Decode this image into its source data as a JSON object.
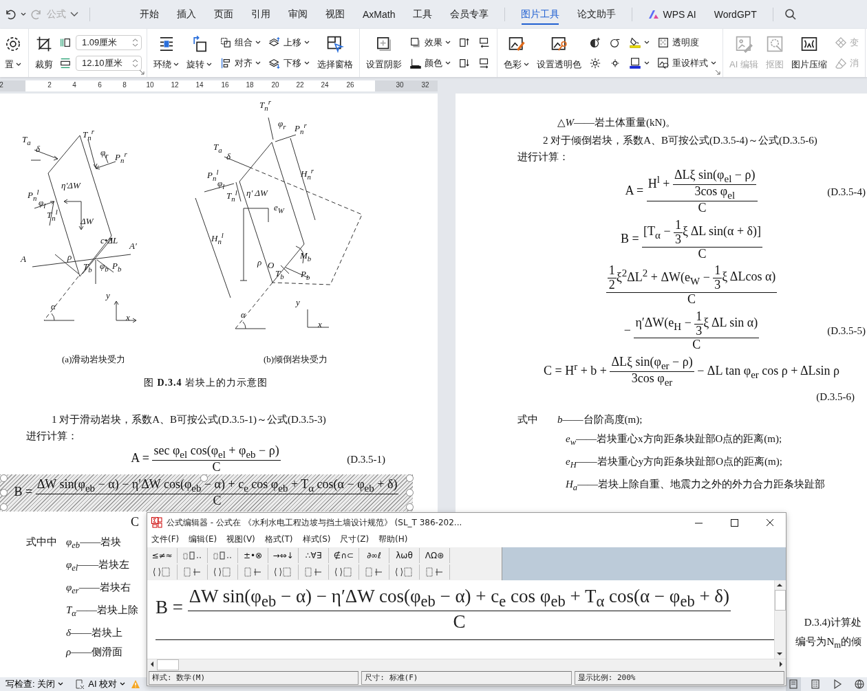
{
  "quick_access": {
    "title": "公式"
  },
  "tab_groups": [
    [
      {
        "label": "开始",
        "selected": false,
        "kind": "plain"
      },
      {
        "label": "插入",
        "selected": false,
        "kind": "plain"
      },
      {
        "label": "页面",
        "selected": false,
        "kind": "plain"
      },
      {
        "label": "引用",
        "selected": false,
        "kind": "plain"
      },
      {
        "label": "审阅",
        "selected": false,
        "kind": "plain"
      },
      {
        "label": "视图",
        "selected": false,
        "kind": "plain"
      },
      {
        "label": "AxMath",
        "selected": false,
        "kind": "plain"
      },
      {
        "label": "工具",
        "selected": false,
        "kind": "plain"
      },
      {
        "label": "会员专享",
        "selected": false,
        "kind": "plain"
      }
    ],
    [
      {
        "label": "图片工具",
        "selected": true,
        "kind": "plain"
      },
      {
        "label": "论文助手",
        "selected": false,
        "kind": "plain"
      }
    ],
    [
      {
        "label": "WPS AI",
        "selected": false,
        "kind": "ai"
      },
      {
        "label": "WordGPT",
        "selected": false,
        "kind": "plain"
      }
    ]
  ],
  "ribbon": {
    "groups": [
      {
        "items": [
          {
            "kind": "large",
            "label": "置",
            "chevron": true,
            "disabled": false
          }
        ]
      },
      {
        "items": [
          {
            "kind": "large",
            "label": "裁剪",
            "chevron": false,
            "disabled": false
          },
          {
            "kind": "stack",
            "rows": [
              {
                "kind": "field",
                "value": "1.09厘米"
              },
              {
                "kind": "field",
                "value": "12.10厘米"
              }
            ]
          },
          {
            "kind": "launcher"
          }
        ]
      },
      {
        "items": [
          {
            "kind": "large",
            "label": "环绕",
            "chevron": true,
            "disabled": false
          },
          {
            "kind": "large",
            "label": "旋转",
            "chevron": true,
            "disabled": false
          },
          {
            "kind": "stack",
            "rows": [
              {
                "kind": "small",
                "label": "组合",
                "chevron": true,
                "disabled": false
              },
              {
                "kind": "small",
                "label": "对齐",
                "chevron": true,
                "disabled": false
              }
            ]
          },
          {
            "kind": "stack",
            "rows": [
              {
                "kind": "small",
                "label": "上移",
                "chevron": true,
                "disabled": false
              },
              {
                "kind": "small",
                "label": "下移",
                "chevron": true,
                "disabled": false
              }
            ]
          },
          {
            "kind": "large",
            "label": "选择窗格",
            "chevron": false,
            "disabled": false
          }
        ]
      },
      {
        "items": [
          {
            "kind": "large",
            "label": "设置阴影",
            "chevron": false,
            "disabled": false
          },
          {
            "kind": "stack",
            "rows": [
              {
                "kind": "small",
                "label": "效果",
                "chevron": true,
                "disabled": false
              },
              {
                "kind": "small",
                "label": "颜色",
                "chevron": true,
                "disabled": false
              }
            ]
          },
          {
            "kind": "stack",
            "rows": [
              {
                "kind": "icon",
                "chevron": false
              },
              {
                "kind": "icon",
                "chevron": false
              }
            ]
          },
          {
            "kind": "stack",
            "rows": [
              {
                "kind": "icon",
                "chevron": false
              },
              {
                "kind": "icon",
                "chevron": false
              }
            ]
          }
        ]
      },
      {
        "items": [
          {
            "kind": "large",
            "label": "色彩",
            "chevron": true,
            "disabled": false
          },
          {
            "kind": "large",
            "label": "设置透明色",
            "chevron": false,
            "disabled": false
          },
          {
            "kind": "stack",
            "rows": [
              {
                "kind": "icon",
                "chevron": false
              },
              {
                "kind": "icon",
                "chevron": false
              }
            ]
          },
          {
            "kind": "stack",
            "rows": [
              {
                "kind": "icon",
                "chevron": false
              },
              {
                "kind": "icon",
                "chevron": false
              }
            ]
          },
          {
            "kind": "stack",
            "rows": [
              {
                "kind": "icon",
                "chevron": true
              },
              {
                "kind": "icon",
                "chevron": true
              }
            ]
          },
          {
            "kind": "stack",
            "rows": [
              {
                "kind": "small",
                "label": "透明度",
                "chevron": false,
                "disabled": false
              },
              {
                "kind": "small",
                "label": "重设样式",
                "chevron": true,
                "disabled": false
              }
            ]
          },
          {
            "kind": "launcher"
          }
        ]
      },
      {
        "items": [
          {
            "kind": "large",
            "label": "AI 编辑",
            "chevron": false,
            "disabled": true
          },
          {
            "kind": "large",
            "label": "抠图",
            "chevron": false,
            "disabled": true
          },
          {
            "kind": "large",
            "label": "图片压缩",
            "chevron": false,
            "disabled": false
          },
          {
            "kind": "stack",
            "rows": [
              {
                "kind": "small",
                "label": "变",
                "chevron": false,
                "disabled": true
              },
              {
                "kind": "small",
                "label": "消",
                "chevron": false,
                "disabled": true
              }
            ]
          }
        ]
      }
    ]
  },
  "ruler": {
    "ticks": [
      "2",
      "2",
      "4",
      "6",
      "8",
      "10",
      "12",
      "14",
      "16",
      "18",
      "20",
      "22",
      "24",
      "26",
      "30",
      "32"
    ]
  },
  "left_page": {
    "figures": [
      {
        "caption": "(a)滑动岩块受力",
        "labels": [
          "T$_{a}$",
          "δ",
          "T$_{n}$$^{r}$",
          "φ$_{r}$",
          "P$_{n}$$^{r}$",
          "η′ΔW",
          "P$_{n}$$^{l}$",
          "φ$_{l}$",
          "T$_{n}$$^{l}$",
          "ΔW",
          "c•ΔL",
          "A",
          "A′",
          "ρ",
          "T$_{b}$",
          "φ$_{b}$",
          "P$_{b}$",
          "y",
          "x",
          "α"
        ]
      },
      {
        "caption": "(b)倾倒岩块受力",
        "labels": [
          "T$_{n}$$^{r}$",
          "φ$_{r}$",
          "P$_{n}$$^{r}$",
          "T$_{a}$",
          "δ",
          "P$_{n}$$^{l}$",
          "φ$_{l}$",
          "T$_{n}$$^{l}$",
          "η′ ΔW",
          "e$_{W}$",
          "H$_{n}$$^{r}$",
          "H$_{n}$$^{l}$",
          "M$_{b}$",
          "ρ",
          "O",
          "T$_{b}$",
          "P$_{b}$",
          "y",
          "x",
          "α"
        ]
      }
    ],
    "figure_caption": "图 **D.3.4** 岩块上的力示意图",
    "blocks": [
      {
        "kind": "para",
        "text": "1 对于滑动岩块，系数A、B可按公式(D.3.5-1)～公式(D.3.5-3)"
      },
      {
        "kind": "line",
        "text": "进行计算："
      },
      {
        "kind": "formula",
        "label": "(D.3.5-1)",
        "selected": false,
        "parts": [
          {
            "text": "A = "
          },
          {
            "fraction": {
              "num": [
                {
                  "text": "sec φ$_{el}$ cos(φ$_{el}$ + φ$_{eb}$ − ρ)"
                }
              ],
              "den": [
                {
                  "text": "C"
                }
              ]
            }
          }
        ]
      },
      {
        "kind": "formula",
        "selected": true,
        "parts": [
          {
            "text": "B = "
          },
          {
            "fraction": {
              "num": [
                {
                  "text": "ΔW sin(φ$_{eb}$ − α) − η′ΔW cos(φ$_{eb}$ − α) + c$_{e}$ cos φ$_{eb}$ + T$_{α}$ cos(α − φ$_{eb}$ + δ)"
                }
              ],
              "den": [
                {
                  "text": "C"
                }
              ]
            }
          }
        ]
      },
      {
        "kind": "partial",
        "text": "C"
      },
      {
        "kind": "def",
        "lead": "式中中",
        "term": "φ$_{eb}$",
        "text": "——岩块"
      },
      {
        "kind": "def",
        "term": "φ$_{el}$",
        "text": "——岩块左"
      },
      {
        "kind": "def",
        "term": "φ$_{er}$",
        "text": "——岩块右"
      },
      {
        "kind": "def",
        "term": "T$_{α}$",
        "text": "——岩块上除"
      },
      {
        "kind": "def",
        "term": "δ",
        "text": "——岩块上"
      },
      {
        "kind": "def",
        "term": "ρ",
        "text": "——侧滑面"
      }
    ]
  },
  "right_page": {
    "blocks": [
      {
        "kind": "def",
        "term": "△W",
        "text": "——岩土体重量(kN)。"
      },
      {
        "kind": "para",
        "text": "2 对于倾倒岩块，系数A、B可按公式(D.3.5-4)～公式(D.3.5-6)"
      },
      {
        "kind": "line",
        "text": "进行计算："
      },
      {
        "kind": "formula",
        "label": "(D.3.5-4)",
        "selected": false,
        "parts": [
          {
            "text": "A = "
          },
          {
            "fraction": {
              "num": [
                {
                  "text": "H$^{l}$ + "
                },
                {
                  "fraction": {
                    "num": [
                      {
                        "text": "ΔLξ sin(φ$_{el}$ − ρ)"
                      }
                    ],
                    "den": [
                      {
                        "text": "3cos φ$_{el}$"
                      }
                    ]
                  }
                }
              ],
              "den": [
                {
                  "text": "C"
                }
              ]
            }
          }
        ]
      },
      {
        "kind": "formula",
        "selected": false,
        "parts": [
          {
            "text": "B = "
          },
          {
            "fraction": {
              "num": [
                {
                  "text": "[T$_{α}$ − "
                },
                {
                  "fraction": {
                    "num": [
                      {
                        "text": "1"
                      }
                    ],
                    "den": [
                      {
                        "text": "3"
                      }
                    ]
                  }
                },
                {
                  "text": "ξ ΔL sin(α + δ)]"
                }
              ],
              "den": [
                {
                  "text": "C"
                }
              ]
            }
          }
        ]
      },
      {
        "kind": "formula",
        "selected": false,
        "parts": [
          {
            "fraction": {
              "num": [
                {
                  "fraction": {
                    "num": [
                      {
                        "text": "1"
                      }
                    ],
                    "den": [
                      {
                        "text": "2"
                      }
                    ]
                  }
                },
                {
                  "text": "ξ$^{2}$ΔL$^{2}$ + ΔW(e$_{W}$ − "
                },
                {
                  "fraction": {
                    "num": [
                      {
                        "text": "1"
                      }
                    ],
                    "den": [
                      {
                        "text": "3"
                      }
                    ]
                  }
                },
                {
                  "text": "ξ ΔLcos α)"
                }
              ],
              "den": [
                {
                  "text": "C"
                }
              ]
            }
          }
        ]
      },
      {
        "kind": "formula",
        "label": "(D.3.5-5)",
        "selected": false,
        "parts": [
          {
            "text": "− "
          },
          {
            "fraction": {
              "num": [
                {
                  "text": "η′ΔW(e$_{H}$ − "
                },
                {
                  "fraction": {
                    "num": [
                      {
                        "text": "1"
                      }
                    ],
                    "den": [
                      {
                        "text": "3"
                      }
                    ]
                  }
                },
                {
                  "text": "ξ ΔL sin α)"
                }
              ],
              "den": [
                {
                  "text": "C"
                }
              ]
            }
          }
        ]
      },
      {
        "kind": "formula",
        "selected": false,
        "parts": [
          {
            "text": "C = H$^{r}$ + b + "
          },
          {
            "fraction": {
              "num": [
                {
                  "text": "ΔLξ sin(φ$_{er}$ − ρ)"
                }
              ],
              "den": [
                {
                  "text": "3cos φ$_{er}$"
                }
              ]
            }
          },
          {
            "text": " − ΔL tan φ$_{er}$ cos ρ + ΔLsin ρ"
          }
        ]
      },
      {
        "kind": "eqlabel",
        "text": "(D.3.5-6)"
      },
      {
        "kind": "def",
        "lead": "式中",
        "term": "b",
        "text": "——台阶高度(m);"
      },
      {
        "kind": "def",
        "term": "e$_{w}$",
        "text": "——岩块重心x方向距条块趾部O点的距离(m);"
      },
      {
        "kind": "def",
        "term": "e$_{H}$",
        "text": "——岩块重心y方向距条块趾部O点的距离(m);"
      },
      {
        "kind": "def",
        "term": "H$_{a}$",
        "text": "——岩块上除自重、地震力之外的外力合力距条块趾部"
      },
      {
        "kind": "tail",
        "text": "D.3.4)计算处"
      },
      {
        "kind": "tail",
        "text": "编号为N$_{m}$的倾"
      }
    ]
  },
  "editor": {
    "title": "公式编辑器 - 公式在 《水利水电工程边坡与挡土墙设计规范》 (SL_T 386-202...",
    "menu": [
      "文件(F)",
      "编辑(E)",
      "视图(V)",
      "格式(T)",
      "样式(S)",
      "尺寸(Z)",
      "帮助(H)"
    ],
    "palette": [
      {
        "kind": "text",
        "text": "≤≠≈"
      },
      {
        "kind": "icon"
      },
      {
        "kind": "icon"
      },
      {
        "kind": "text",
        "text": "±•⊗"
      },
      {
        "kind": "text",
        "text": "→⇔↓"
      },
      {
        "kind": "text",
        "text": "∴∀∃"
      },
      {
        "kind": "text",
        "text": "∉∩⊂"
      },
      {
        "kind": "text",
        "text": "∂∞ℓ"
      },
      {
        "kind": "text",
        "text": "λωθ"
      },
      {
        "kind": "text",
        "text": "ΛΩ⊛"
      }
    ],
    "formula": [
      {
        "text": "B = "
      },
      {
        "fraction": {
          "num": [
            {
              "text": "ΔW sin(φ$_{eb}$ − α) − η′ΔW cos(φ$_{eb}$ − α) + c$_{e}$ cos φ$_{eb}$ + T$_{α}$ cos(α − φ$_{eb}$ + δ)"
            }
          ],
          "den": [
            {
              "text": "C"
            }
          ]
        }
      }
    ],
    "status": [
      "样式: 数学(M)",
      "尺寸: 标准(F)",
      "显示比例: 200%"
    ]
  },
  "status_bar": {
    "items": [
      {
        "label": "写检查: 关闭",
        "kind": "plain"
      },
      {
        "label": "AI 校对",
        "kind": "ai"
      }
    ],
    "views": [
      {
        "selected": true
      },
      {
        "selected": false
      },
      {
        "selected": false
      },
      {
        "selected": false
      }
    ]
  }
}
